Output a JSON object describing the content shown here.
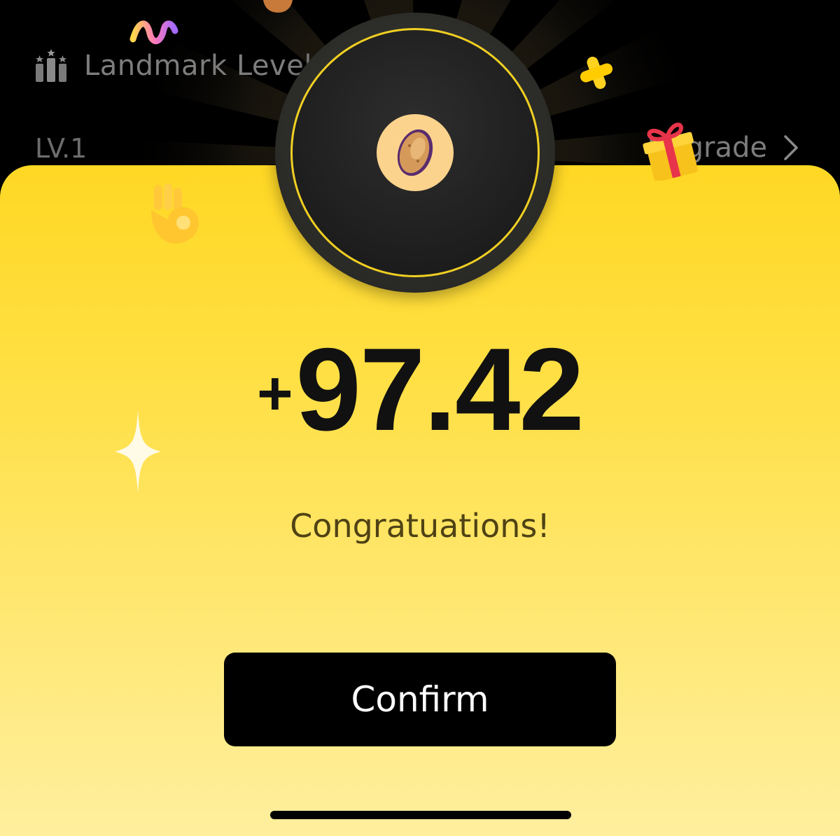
{
  "header": {
    "title": "Landmark Level",
    "level_label": "LV.1",
    "upgrade_label": "Upgrade",
    "icons": [
      "level-bars-icon",
      "chevron-right-icon"
    ]
  },
  "reward": {
    "amount_sign": "+",
    "amount_value": "97.42",
    "message": "Congratuations!",
    "coin_icon": "potato-coin-icon"
  },
  "actions": {
    "confirm_label": "Confirm"
  },
  "decorations": [
    "gift-icon",
    "ok-hand-icon",
    "cross-sparkle-icon",
    "squiggle-icon",
    "star-sparkle-icon"
  ],
  "colors": {
    "background": "#000000",
    "sheet_top": "#ffd824",
    "sheet_bottom": "#ffef9e",
    "button": "#000000",
    "ring_accent": "#f0cf22",
    "coin": "#fcd38d"
  }
}
